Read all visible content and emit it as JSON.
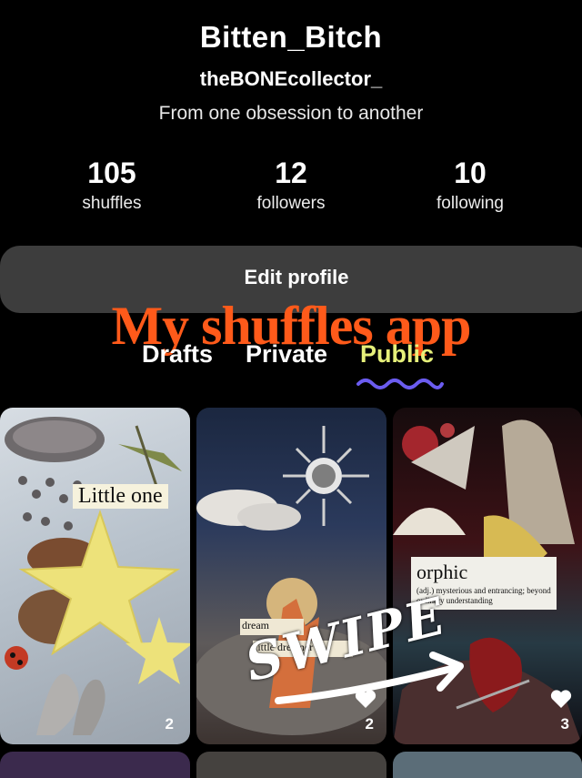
{
  "profile": {
    "display_name": "Bitten_Bitch",
    "username": "theBONEcollector_",
    "bio": "From one obsession to another"
  },
  "stats": [
    {
      "value": "105",
      "label": "shuffles"
    },
    {
      "value": "12",
      "label": "followers"
    },
    {
      "value": "10",
      "label": "following"
    }
  ],
  "edit_profile_label": "Edit profile",
  "overlay": {
    "title": "My shuffles app",
    "swipe": "SWIPE",
    "title_color": "#ff5a1a"
  },
  "tabs": [
    {
      "label": "Drafts",
      "active": false
    },
    {
      "label": "Private",
      "active": false
    },
    {
      "label": "Public",
      "active": true
    }
  ],
  "accent": "#e6f07a",
  "squiggle_color": "#6b5cf0",
  "cards": [
    {
      "caption": "Little one",
      "likes": "2",
      "liked_icon": false
    },
    {
      "caption_lines": [
        "dream",
        "little dreamer"
      ],
      "likes": "2",
      "liked_icon": true
    },
    {
      "caption": "orphic",
      "definition": "(adj.) mysterious and entrancing; beyond ordinary understanding",
      "likes": "3",
      "liked_icon": true
    }
  ]
}
